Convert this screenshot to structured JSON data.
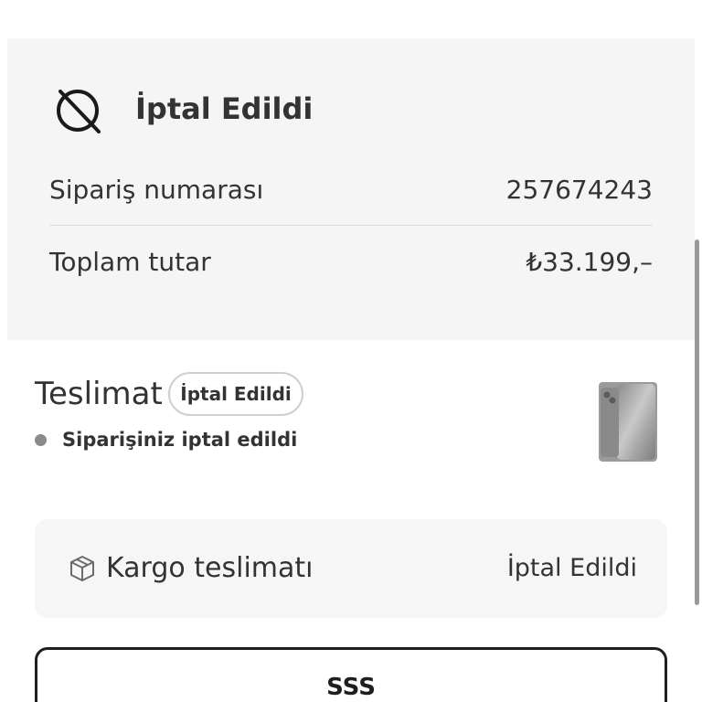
{
  "order_summary": {
    "status_icon": "cancelled-clock-icon",
    "status_title": "İptal Edildi",
    "order_number_label": "Sipariş numarası",
    "order_number_value": "257674243",
    "total_label": "Toplam tutar",
    "total_value": "₺33.199,–"
  },
  "delivery": {
    "title": "Teslimat",
    "badge": "İptal Edildi",
    "status_text": "Siparişiniz iptal edildi",
    "product_image": "phone-product-image"
  },
  "shipping": {
    "icon": "package-icon",
    "label": "Kargo teslimatı",
    "status": "İptal Edildi"
  },
  "faq": {
    "label": "SSS"
  }
}
